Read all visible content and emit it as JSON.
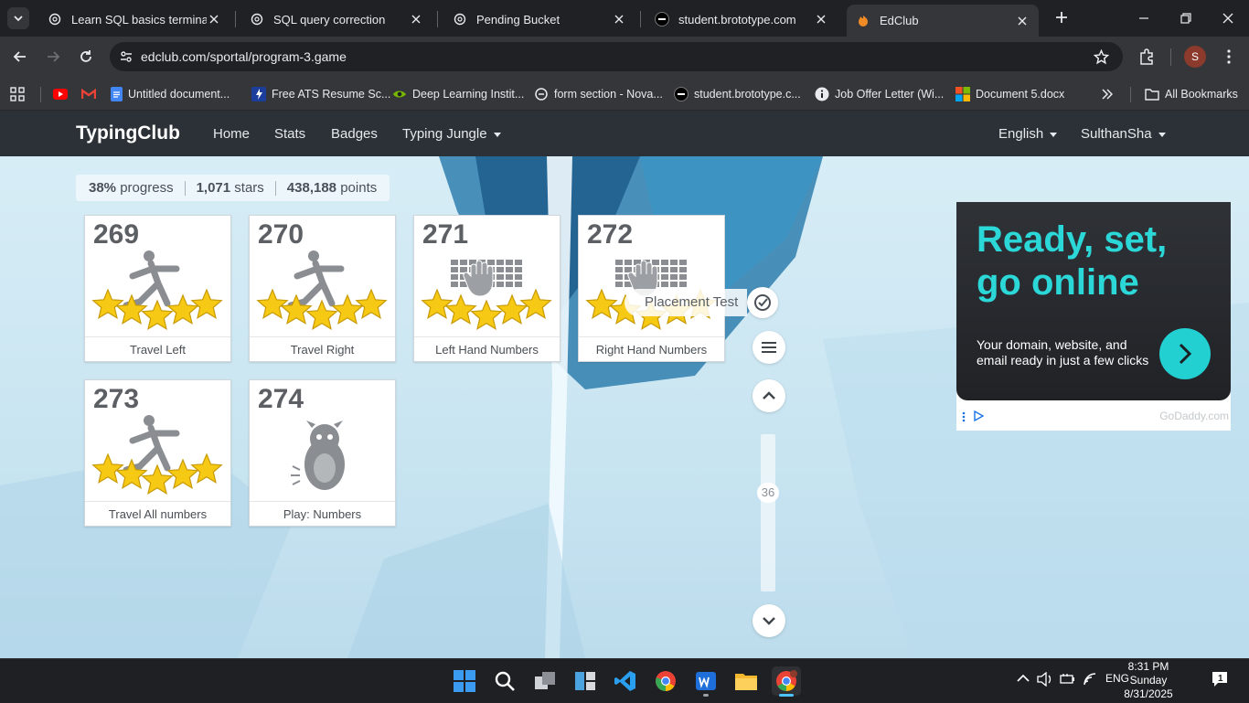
{
  "browser": {
    "tabs": [
      {
        "title": "Learn SQL basics terminal",
        "icon": "chatgpt-icon"
      },
      {
        "title": "SQL query correction",
        "icon": "chatgpt-icon"
      },
      {
        "title": "Pending Bucket",
        "icon": "chatgpt-icon"
      },
      {
        "title": "student.brototype.com",
        "icon": "brototype-icon"
      },
      {
        "title": "EdClub",
        "icon": "edclub-icon",
        "active": true
      }
    ],
    "url": "edclub.com/sportal/program-3.game",
    "profile_initial": "S",
    "bookmarks": [
      {
        "label": "",
        "icon": "youtube-icon"
      },
      {
        "label": "",
        "icon": "gmail-icon"
      },
      {
        "label": "Untitled document...",
        "icon": "docs-icon"
      },
      {
        "label": "Free ATS Resume Sc...",
        "icon": "resume-icon"
      },
      {
        "label": "Deep Learning Instit...",
        "icon": "nvidia-icon"
      },
      {
        "label": "form section - Nova...",
        "icon": "nova-icon"
      },
      {
        "label": "student.brototype.c...",
        "icon": "brototype-icon"
      },
      {
        "label": "Job Offer Letter (Wi...",
        "icon": "info-icon"
      },
      {
        "label": "Document 5.docx",
        "icon": "microsoft-icon"
      }
    ],
    "all_bookmarks": "All Bookmarks"
  },
  "site": {
    "logo": "TypingClub",
    "nav": [
      "Home",
      "Stats",
      "Badges",
      "Typing Jungle"
    ],
    "language": "English",
    "user": "SulthanSha"
  },
  "stats": {
    "progress_value": "38%",
    "progress_label": "progress",
    "stars_value": "1,071",
    "stars_label": "stars",
    "points_value": "438,188",
    "points_label": "points"
  },
  "lessons": [
    {
      "number": "269",
      "title": "Travel Left",
      "art": "pose",
      "stars": 5
    },
    {
      "number": "270",
      "title": "Travel Right",
      "art": "pose",
      "stars": 5
    },
    {
      "number": "271",
      "title": "Left Hand Numbers",
      "art": "keyboard",
      "stars": 5
    },
    {
      "number": "272",
      "title": "Right Hand Numbers",
      "art": "keyboard",
      "stars": 5
    },
    {
      "number": "273",
      "title": "Travel All numbers",
      "art": "pose",
      "stars": 5
    },
    {
      "number": "274",
      "title": "Play: Numbers",
      "art": "game",
      "stars": 0
    }
  ],
  "placement_test": "Placement Test",
  "scroll_level": "36",
  "ad": {
    "headline": "Ready, set, go online",
    "body": "Your domain, website, and email ready in just a few clicks",
    "brand": "GoDaddy.com",
    "accent": "#2cd7d8"
  },
  "taskbar": {
    "lang": "ENG",
    "time": "8:31 PM",
    "day": "Sunday",
    "date": "8/31/2025",
    "notifications": "1"
  }
}
